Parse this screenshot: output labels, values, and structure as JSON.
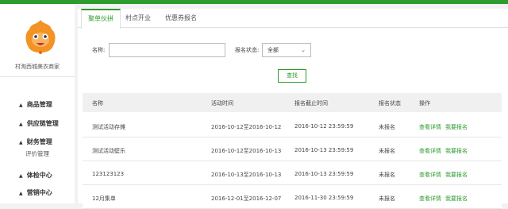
{
  "sidebar": {
    "shop_name": "村淘西城美衣商家",
    "menu": [
      {
        "label": "商品管理",
        "caret": "▲"
      },
      {
        "label": "供应链管理",
        "caret": "▲"
      },
      {
        "label": "财务管理",
        "caret": "▲"
      },
      {
        "label": "体检中心",
        "caret": "▲"
      },
      {
        "label": "营销中心",
        "caret": "▲"
      }
    ],
    "submenu": {
      "finance_eval": "评价管理"
    }
  },
  "tabs": [
    {
      "label": "聚单伙拼",
      "active": true
    },
    {
      "label": "村点开业",
      "active": false
    },
    {
      "label": "优惠券报名",
      "active": false
    }
  ],
  "filters": {
    "name_label": "名称:",
    "name_value": "",
    "status_label": "报名状态:",
    "status_value": "全部",
    "search_label": "查找"
  },
  "table": {
    "columns": [
      "名称",
      "活动时间",
      "报名截止时间",
      "报名状态",
      "操作"
    ],
    "rows": [
      {
        "name": "测试活动存摊",
        "time": "2016-10-12至2016-10-12",
        "deadline": "2016-10-12 23:59:59",
        "status": "未报名",
        "detail": "查看详情",
        "signup": "我要报名"
      },
      {
        "name": "测试活动壁乐",
        "time": "2016-10-12至2016-10-13",
        "deadline": "2016-10-13 23:59:59",
        "status": "未报名",
        "detail": "查看详情",
        "signup": "我要报名"
      },
      {
        "name": "123123123",
        "time": "2016-10-13至2016-10-13",
        "deadline": "2016-10-13 23:59:59",
        "status": "未报名",
        "detail": "查看详情",
        "signup": "我要报名"
      },
      {
        "name": "12月集单",
        "time": "2016-12-01至2016-12-07",
        "deadline": "2016-11-30 23:59:59",
        "status": "未报名",
        "detail": "查看详情",
        "signup": "我要报名"
      }
    ]
  },
  "colors": {
    "accent": "#2e9b2e",
    "avatar": "#f39323"
  }
}
